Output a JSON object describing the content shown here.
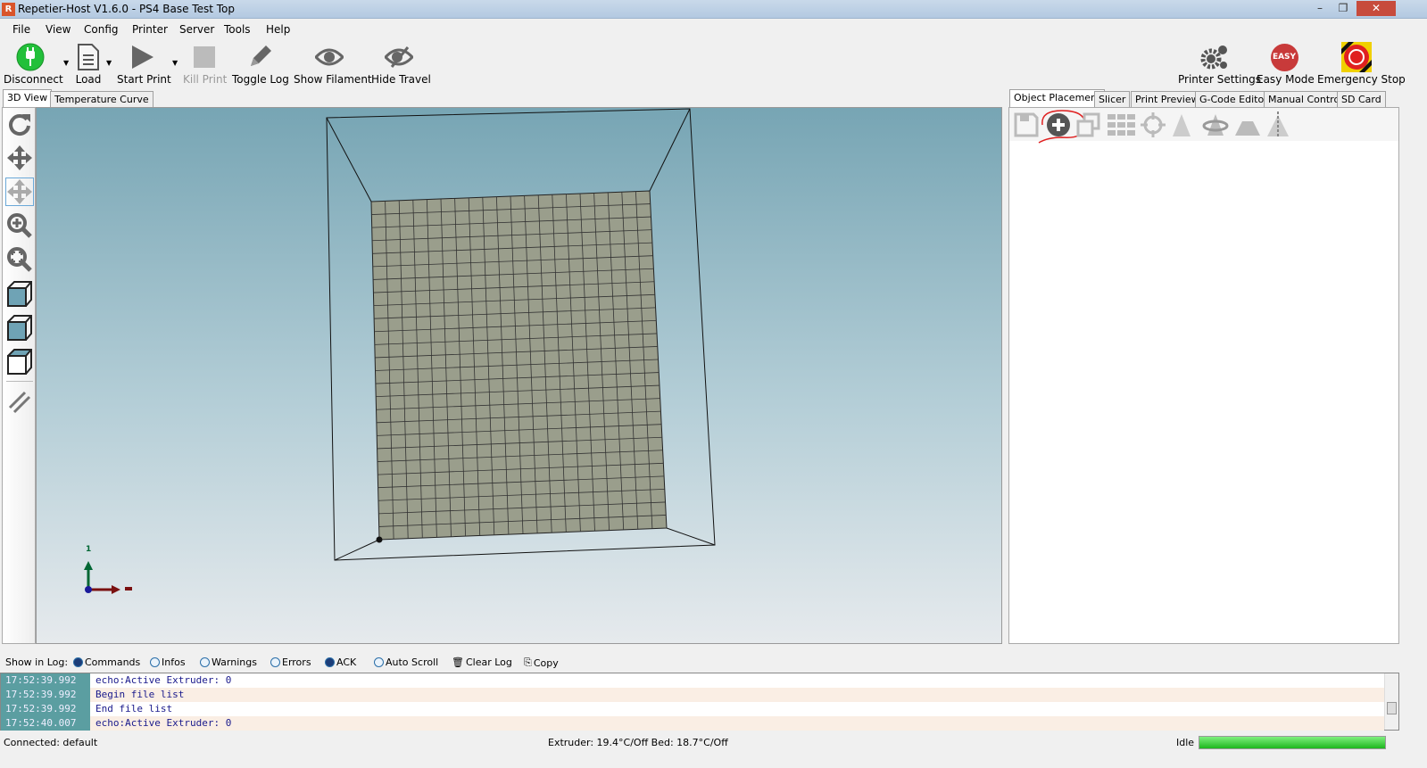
{
  "window": {
    "title": "Repetier-Host V1.6.0 - PS4 Base Test Top",
    "app_icon": "R"
  },
  "menu": [
    "File",
    "View",
    "Config",
    "Printer",
    "Server",
    "Tools",
    "Help"
  ],
  "toolbar": {
    "disconnect": "Disconnect",
    "load": "Load",
    "start_print": "Start Print",
    "kill_print": "Kill Print",
    "toggle_log": "Toggle Log",
    "show_filament": "Show Filament",
    "hide_travel": "Hide Travel",
    "printer_settings": "Printer Settings",
    "easy_mode": "Easy Mode",
    "easy_badge": "EASY",
    "emergency_stop": "Emergency Stop"
  },
  "left_tabs": [
    "3D View",
    "Temperature Curve"
  ],
  "right_tabs": [
    "Object Placement",
    "Slicer",
    "Print Preview",
    "G-Code Editor",
    "Manual Control",
    "SD Card"
  ],
  "axis_label": "1",
  "log_filters": {
    "label": "Show in Log:",
    "items": [
      {
        "label": "Commands",
        "on": true
      },
      {
        "label": "Infos",
        "on": false
      },
      {
        "label": "Warnings",
        "on": false
      },
      {
        "label": "Errors",
        "on": false
      },
      {
        "label": "ACK",
        "on": true
      },
      {
        "label": "Auto Scroll",
        "on": false
      }
    ],
    "clear": "Clear Log",
    "copy": "Copy"
  },
  "log": [
    {
      "time": "17:52:39.992",
      "msg": "echo:Active Extruder: 0"
    },
    {
      "time": "17:52:39.992",
      "msg": "Begin file list"
    },
    {
      "time": "17:52:39.992",
      "msg": "End file list"
    },
    {
      "time": "17:52:40.007",
      "msg": "echo:Active Extruder: 0"
    }
  ],
  "status": {
    "connection": "Connected: default",
    "temps": "Extruder: 19.4°C/Off Bed: 18.7°C/Off",
    "state": "Idle",
    "progress": 1.0
  },
  "colors": {
    "accent_green": "#22c03a",
    "log_time_bg": "#5b9ea1",
    "bed": "#9a9e8c"
  }
}
